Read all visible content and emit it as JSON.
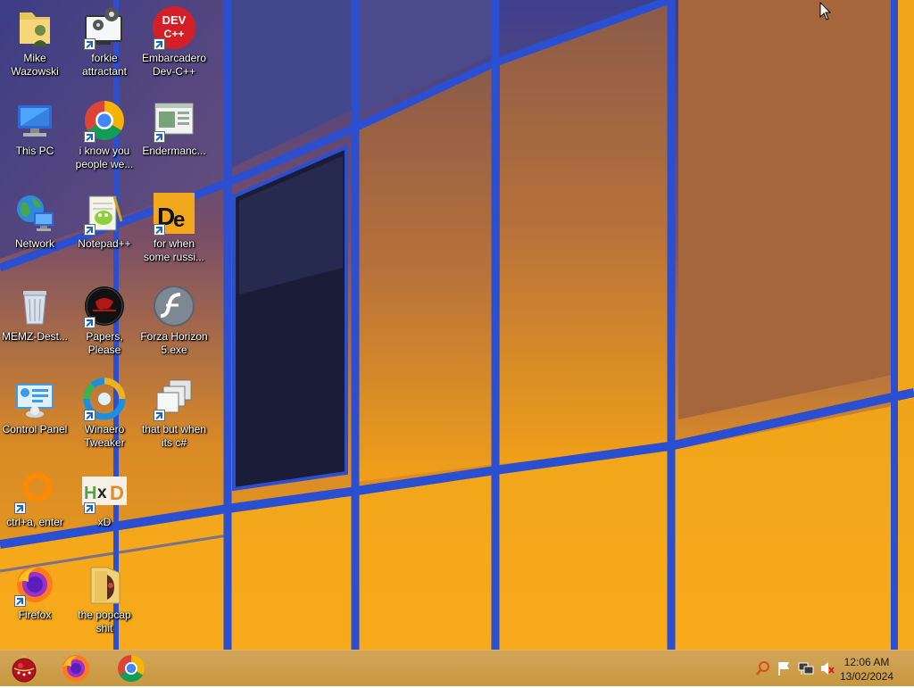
{
  "desktop": {
    "icons": [
      {
        "label": "Mike\nWazowski",
        "icon": "user-folder-icon"
      },
      {
        "label": "forkie attractant",
        "icon": "settings-computer-icon"
      },
      {
        "label": "Embarcadero Dev-C++",
        "icon": "devcpp-icon",
        "badge": "DEV C++"
      },
      {
        "label": "This PC",
        "icon": "computer-icon"
      },
      {
        "label": "i know you people we...",
        "icon": "chrome-icon"
      },
      {
        "label": "Endermanc...",
        "icon": "window-app-icon"
      },
      {
        "label": "Network",
        "icon": "network-icon"
      },
      {
        "label": "Notepad++",
        "icon": "notepadpp-icon"
      },
      {
        "label": "for when some russi...",
        "icon": "de-app-icon",
        "badge": "De"
      },
      {
        "label": "MEMZ-Dest...",
        "icon": "recycle-bin-icon"
      },
      {
        "label": "Papers, Please",
        "icon": "papers-please-icon"
      },
      {
        "label": "Forza Horizon 5.exe",
        "icon": "flash-icon"
      },
      {
        "label": "Control Panel",
        "icon": "control-panel-icon"
      },
      {
        "label": "Winaero Tweaker",
        "icon": "winaero-icon"
      },
      {
        "label": "that but when its c#",
        "icon": "stacked-windows-icon"
      },
      {
        "label": "ctrl+a, enter",
        "icon": "ring-icon"
      },
      {
        "label": "xD",
        "icon": "hxd-icon",
        "badge": "HxD"
      },
      {
        "label": "Firefox",
        "icon": "firefox-icon"
      },
      {
        "label": "the popcap shit",
        "icon": "folder-icon"
      }
    ]
  },
  "taskbar": {
    "apps": [
      {
        "name": "start-orb",
        "icon": "ornament-start-icon"
      },
      {
        "name": "firefox",
        "icon": "firefox-icon"
      },
      {
        "name": "chrome",
        "icon": "chrome-icon"
      }
    ],
    "tray": [
      "search-icon",
      "flag-icon",
      "network-tray-icon",
      "volume-muted-icon"
    ],
    "clock": {
      "time": "12:06 AM",
      "date": "13/02/2024"
    }
  },
  "colors": {
    "taskbar": "#c8983f",
    "wall_orange": "#f3a619",
    "frame_blue": "#2a4fd0"
  }
}
